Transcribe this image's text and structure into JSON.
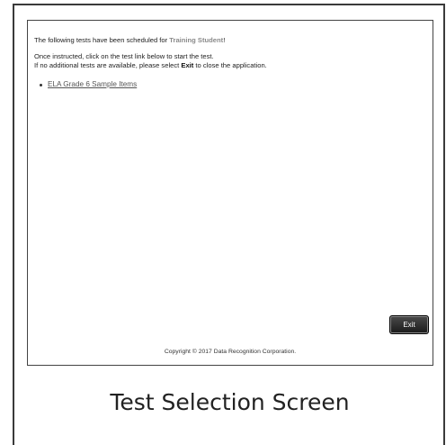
{
  "screen": {
    "intro_prefix": "The following tests have been scheduled for ",
    "student_name": "Training Student",
    "intro_suffix": "!",
    "instruction_line1": "Once instructed, click on the test link below to start the test.",
    "instruction_line2_prefix": "If no additional tests are available, please select ",
    "instruction_line2_bold": "Exit",
    "instruction_line2_suffix": " to close the application.",
    "tests": [
      {
        "label": "ELA Grade 6 Sample Items"
      }
    ],
    "exit_button_label": "Exit",
    "copyright": "Copyright © 2017 Data Recognition Corporation."
  },
  "caption": "Test Selection Screen"
}
